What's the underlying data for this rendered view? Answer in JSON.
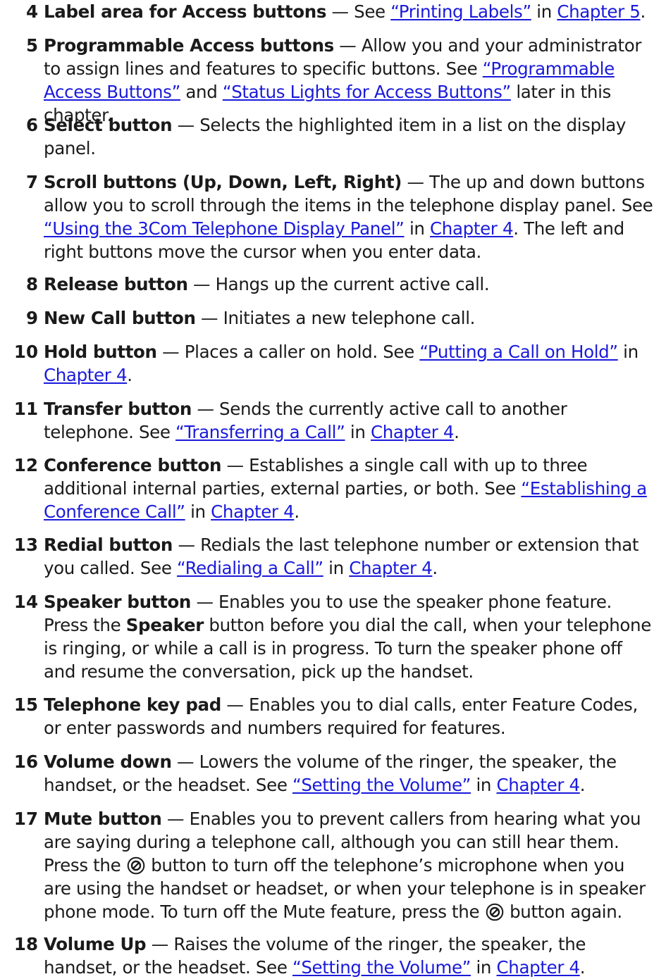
{
  "dash": "—",
  "items": [
    {
      "num": "4",
      "term": "Label area for Access buttons",
      "t1": "See ",
      "l1": "“Printing Labels”",
      "t2": " in ",
      "l2": "Chapter 5",
      "t3": "."
    },
    {
      "num": "5",
      "term": "Programmable Access buttons",
      "t1": "Allow you and your administrator to assign lines and features to specific buttons. See ",
      "l1": "“Programmable Access Buttons”",
      "t2": " and ",
      "l2": "“Status Lights for Access Buttons”",
      "t3": " later in this chapter."
    },
    {
      "num": "6",
      "term": "Select button",
      "t1": "Selects the highlighted item in a list on the display panel."
    },
    {
      "num": "7",
      "term": "Scroll buttons (Up, Down, Left, Right)",
      "t1": "The up and down buttons allow you to scroll through the items in the telephone display panel. See ",
      "l1": "“Using the 3Com Telephone Display Panel”",
      "t2": " in ",
      "l2": "Chapter 4",
      "t3": ". The left and right buttons move the cursor when you enter data."
    },
    {
      "num": "8",
      "term": "Release button",
      "t1": "Hangs up the current active call."
    },
    {
      "num": "9",
      "term": "New Call button",
      "t1": "Initiates a new telephone call."
    },
    {
      "num": "10",
      "term": "Hold button",
      "t1": "Places a caller on hold. See ",
      "l1": "“Putting a Call on Hold”",
      "t2": " in ",
      "l2": "Chapter 4",
      "t3": "."
    },
    {
      "num": "11",
      "term": "Transfer button",
      "t1": "Sends the currently active call to another telephone. See ",
      "l1": "“Transferring a Call”",
      "t2": " in ",
      "l2": "Chapter 4",
      "t3": "."
    },
    {
      "num": "12",
      "term": "Conference button",
      "t1": "Establishes a single call with up to three additional internal parties, external parties, or both. See ",
      "l1": "“Establishing a Conference Call”",
      "t2": " in ",
      "l2": "Chapter 4",
      "t3": "."
    },
    {
      "num": "13",
      "term": "Redial button",
      "t1": "Redials the last telephone number or extension that you called. See ",
      "l1": "“Redialing a Call”",
      "t2": " in ",
      "l2": "Chapter 4",
      "t3": "."
    },
    {
      "num": "14",
      "term": "Speaker button",
      "t1": "Enables you to use the speaker phone feature. Press the ",
      "bold": "Speaker",
      "t2": " button before you dial the call, when your telephone is ringing, or while a call is in progress. To turn the speaker phone off and resume the conversation, pick up the handset."
    },
    {
      "num": "15",
      "term": "Telephone key pad",
      "t1": "Enables you to dial calls, enter Feature Codes, or enter passwords and numbers required for features."
    },
    {
      "num": "16",
      "term": "Volume down",
      "t1": "Lowers the volume of the ringer, the speaker, the handset, or the headset. See ",
      "l1": "“Setting the Volume”",
      "t2": " in ",
      "l2": "Chapter 4",
      "t3": "."
    },
    {
      "num": "17",
      "term": "Mute button",
      "t1": "Enables you to prevent callers from hearing what you are saying during a telephone call, although you can still hear them. Press the ",
      "t2": " button to turn off the telephone’s microphone when you are using the handset or headset, or when your telephone is in speaker phone mode. To turn off the Mute feature, press the ",
      "t3": " button again."
    },
    {
      "num": "18",
      "term": "Volume Up",
      "t1": "Raises the volume of the ringer, the speaker, the handset, or the headset. See ",
      "l1": "“Setting the Volume”",
      "t2": " in ",
      "l2": "Chapter 4",
      "t3": "."
    }
  ]
}
